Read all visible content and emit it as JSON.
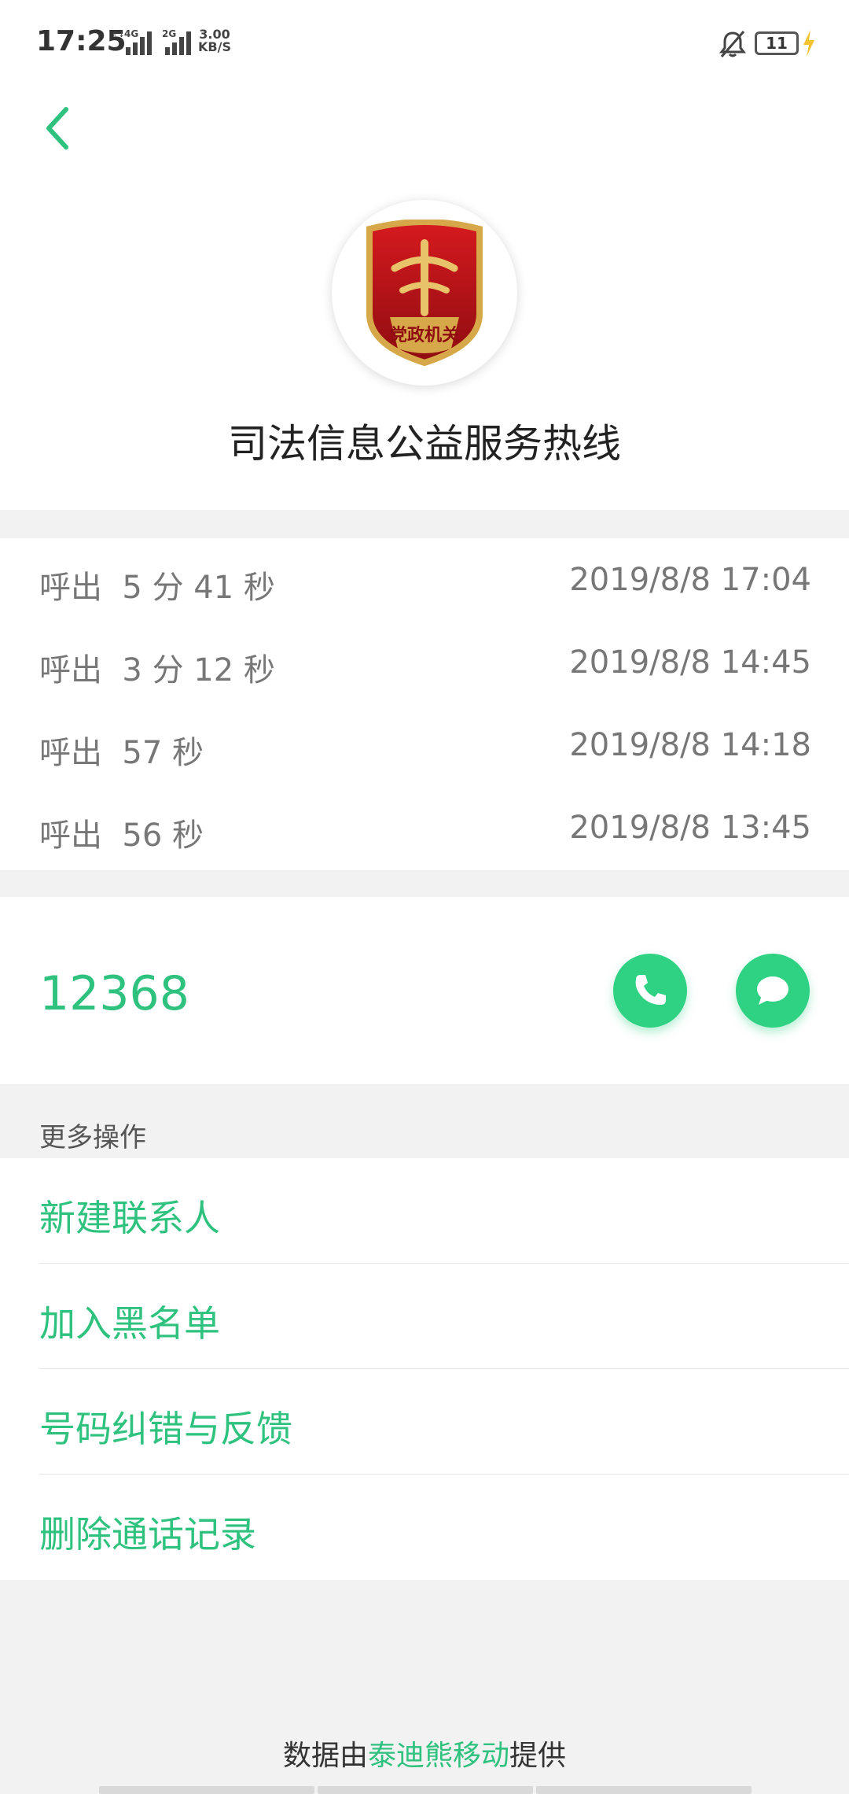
{
  "status_bar": {
    "time": "17:25",
    "net1_tag": "4G",
    "net2_tag": "2G",
    "speed_value": "3.00",
    "speed_unit": "KB/S",
    "battery": "11"
  },
  "header": {
    "contact_name": "司法信息公益服务热线",
    "avatar_badge_text": "党政机关"
  },
  "call_log": [
    {
      "desc": "呼出  5 分 41 秒",
      "time": "2019/8/8 17:04"
    },
    {
      "desc": "呼出  3 分 12 秒",
      "time": "2019/8/8 14:45"
    },
    {
      "desc": "呼出  57 秒",
      "time": "2019/8/8 14:18"
    },
    {
      "desc": "呼出  56 秒",
      "time": "2019/8/8 13:45"
    }
  ],
  "number_card": {
    "number": "12368"
  },
  "more": {
    "title": "更多操作",
    "actions": [
      {
        "label": "新建联系人"
      },
      {
        "label": "加入黑名单"
      },
      {
        "label": "号码纠错与反馈"
      },
      {
        "label": "删除通话记录"
      }
    ]
  },
  "footer": {
    "prefix": "数据由",
    "provider": "泰迪熊移动",
    "suffix": "提供"
  },
  "colors": {
    "accent": "#2ec27e",
    "button_bg": "#2fd283",
    "badge_red": "#c1121c",
    "badge_gold": "#d7a84a"
  }
}
